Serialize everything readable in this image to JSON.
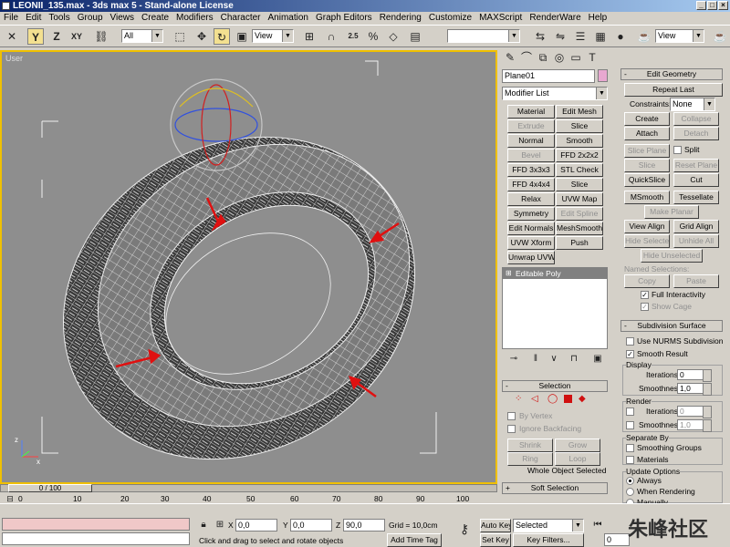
{
  "window": {
    "title": "LEONII_135.max - 3ds max 5 - Stand-alone License"
  },
  "menu": [
    "File",
    "Edit",
    "Tools",
    "Group",
    "Views",
    "Create",
    "Modifiers",
    "Character",
    "Animation",
    "Graph Editors",
    "Rendering",
    "Customize",
    "MAXScript",
    "RenderWare",
    "Help"
  ],
  "toolbar": {
    "selection_filter": "All",
    "ref_coord": "View",
    "ref_coord2": "View",
    "named_selection": "",
    "snap_value": "2.5"
  },
  "viewport": {
    "label": "User"
  },
  "command_panel": {
    "object_name": "Plane01",
    "modifier_list": "Modifier List",
    "buttons": [
      [
        "Material",
        "Edit Mesh"
      ],
      [
        "Extrude",
        "Slice"
      ],
      [
        "Normal",
        "Smooth"
      ],
      [
        "Bevel",
        "FFD 2x2x2"
      ],
      [
        "FFD 3x3x3",
        "STL Check"
      ],
      [
        "FFD 4x4x4",
        "Slice"
      ],
      [
        "Relax",
        "UVW Map"
      ],
      [
        "Symmetry",
        "Edit Spline"
      ],
      [
        "Edit Normals",
        "MeshSmooth"
      ],
      [
        "UVW Xform",
        "Push"
      ],
      [
        "Unwrap UVW",
        ""
      ]
    ],
    "stack_item": "Editable Poly",
    "selection_title": "Selection",
    "by_vertex": "By Vertex",
    "ignore_backfacing": "Ignore Backfacing",
    "shrink": "Shrink",
    "grow": "Grow",
    "ring": "Ring",
    "loop": "Loop",
    "whole_object": "Whole Object Selected",
    "soft_selection": "Soft Selection"
  },
  "edit_geometry": {
    "title": "Edit Geometry",
    "repeat_last": "Repeat Last",
    "constraints": "Constraints:",
    "constraints_value": "None",
    "create": "Create",
    "collapse": "Collapse",
    "attach": "Attach",
    "detach": "Detach",
    "slice_plane": "Slice Plane",
    "split": "Split",
    "slice": "Slice",
    "reset_plane": "Reset Plane",
    "quickslice": "QuickSlice",
    "cut": "Cut",
    "msmooth": "MSmooth",
    "tessellate": "Tessellate",
    "make_planar": "Make Planar",
    "view_align": "View Align",
    "grid_align": "Grid Align",
    "hide_selected": "Hide Selected",
    "unhide_all": "Unhide All",
    "hide_unselected": "Hide Unselected",
    "named_selections": "Named Selections:",
    "copy": "Copy",
    "paste": "Paste",
    "full_interactivity": "Full Interactivity",
    "show_cage": "Show Cage"
  },
  "subdivision": {
    "title": "Subdivision Surface",
    "use_nurms": "Use NURMS Subdivision",
    "smooth_result": "Smooth Result",
    "display": "Display",
    "iterations_label": "Iterations:",
    "iterations": "0",
    "smoothness_label": "Smoothness:",
    "smoothness": "1,0",
    "render": "Render",
    "render_iterations": "0",
    "render_smoothness": "1,0",
    "separate_by": "Separate By",
    "smoothing_groups": "Smoothing Groups",
    "materials": "Materials",
    "update_options": "Update Options",
    "always": "Always",
    "when_rendering": "When Rendering",
    "manually": "Manually"
  },
  "timeline": {
    "frame": "0 / 100",
    "ticks": [
      "0",
      "10",
      "20",
      "30",
      "40",
      "50",
      "60",
      "70",
      "80",
      "90",
      "100"
    ]
  },
  "status": {
    "x_label": "X",
    "x": "0,0",
    "y_label": "Y",
    "y": "0,0",
    "z_label": "Z",
    "z": "90,0",
    "grid": "Grid = 10,0cm",
    "prompt": "Click and drag to select and rotate objects",
    "add_time_tag": "Add Time Tag",
    "auto_key": "Auto Key",
    "set_key": "Set Key",
    "selected": "Selected",
    "key_filters": "Key Filters...",
    "watermark": "朱峰社区",
    "frame_field": "0"
  }
}
